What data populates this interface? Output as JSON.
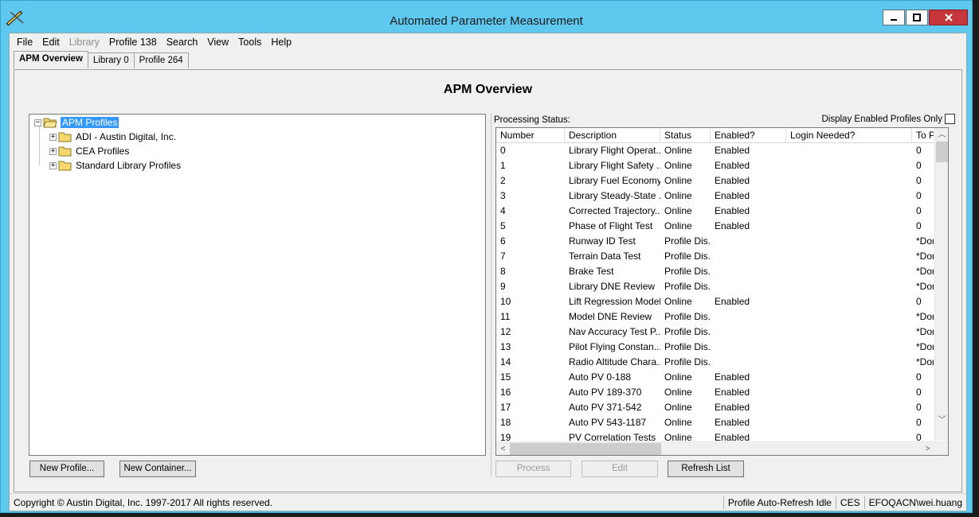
{
  "window": {
    "title": "Automated Parameter Measurement"
  },
  "menu": [
    "File",
    "Edit",
    "Library",
    "Profile 138",
    "Search",
    "View",
    "Tools",
    "Help"
  ],
  "tabs": [
    "APM Overview",
    "Library 0",
    "Profile 264"
  ],
  "page_title": "APM Overview",
  "tree": {
    "root": "APM Profiles",
    "children": [
      "ADI - Austin Digital, Inc.",
      "CEA Profiles",
      "Standard Library Profiles"
    ]
  },
  "buttons": {
    "new_profile": "New Profile...",
    "new_container": "New Container...",
    "process": "Process",
    "edit": "Edit",
    "refresh": "Refresh List"
  },
  "processing_status_label": "Processing Status:",
  "display_enabled_only_label": "Display Enabled Profiles Only",
  "table": {
    "columns": [
      "Number",
      "Description",
      "Status",
      "Enabled?",
      "Login Needed?",
      "To P"
    ],
    "rows": [
      [
        "0",
        "Library Flight Operat...",
        "Online",
        "Enabled",
        "",
        "0"
      ],
      [
        "1",
        "Library Flight Safety ...",
        "Online",
        "Enabled",
        "",
        "0"
      ],
      [
        "2",
        "Library Fuel Economy",
        "Online",
        "Enabled",
        "",
        "0"
      ],
      [
        "3",
        "Library Steady-State ...",
        "Online",
        "Enabled",
        "",
        "0"
      ],
      [
        "4",
        "Corrected Trajectory...",
        "Online",
        "Enabled",
        "",
        "0"
      ],
      [
        "5",
        "Phase of Flight Test",
        "Online",
        "Enabled",
        "",
        "0"
      ],
      [
        "6",
        "Runway ID Test",
        "Profile Dis...",
        "",
        "",
        "*Don"
      ],
      [
        "7",
        "Terrain Data Test",
        "Profile Dis...",
        "",
        "",
        "*Don"
      ],
      [
        "8",
        "Brake Test",
        "Profile Dis...",
        "",
        "",
        "*Don"
      ],
      [
        "9",
        "Library DNE Review",
        "Profile Dis...",
        "",
        "",
        "*Don"
      ],
      [
        "10",
        "Lift Regression Model",
        "Online",
        "Enabled",
        "",
        "0"
      ],
      [
        "11",
        "Model DNE Review",
        "Profile Dis...",
        "",
        "",
        "*Don"
      ],
      [
        "12",
        "Nav Accuracy Test P...",
        "Profile Dis...",
        "",
        "",
        "*Don"
      ],
      [
        "13",
        "Pilot Flying Constan...",
        "Profile Dis...",
        "",
        "",
        "*Don"
      ],
      [
        "14",
        "Radio Altitude Chara...",
        "Profile Dis...",
        "",
        "",
        "*Don"
      ],
      [
        "15",
        "Auto PV 0-188",
        "Online",
        "Enabled",
        "",
        "0"
      ],
      [
        "16",
        "Auto PV 189-370",
        "Online",
        "Enabled",
        "",
        "0"
      ],
      [
        "17",
        "Auto PV 371-542",
        "Online",
        "Enabled",
        "",
        "0"
      ],
      [
        "18",
        "Auto PV 543-1187",
        "Online",
        "Enabled",
        "",
        "0"
      ],
      [
        "19",
        "PV Correlation Tests",
        "Online",
        "Enabled",
        "",
        "0"
      ]
    ]
  },
  "status_bar": {
    "copyright": "Copyright © Austin Digital, Inc. 1997-2017 All rights reserved.",
    "refresh_state": "Profile Auto-Refresh Idle",
    "system": "CES",
    "user": "EFOQACN\\wei.huang"
  },
  "colors": {
    "titlebar": "#5ec8ef",
    "selection": "#3399ff",
    "close_button": "#c7363a"
  }
}
